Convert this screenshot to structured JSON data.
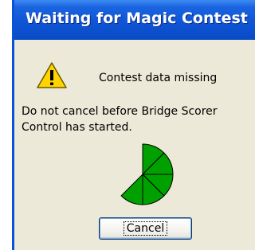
{
  "window": {
    "title": "Waiting for Magic Contest"
  },
  "message": {
    "icon": "warning-icon",
    "title": "Contest data missing",
    "body": "Do not cancel before Bridge Scorer Control has started."
  },
  "progress": {
    "icon": "progress-pie-icon",
    "filled_fraction": 0.625,
    "segments_total": 8,
    "segments_filled": 5,
    "fill_color": "#00a000",
    "stroke_color": "#000000"
  },
  "buttons": {
    "cancel_label": "Cancel"
  },
  "colors": {
    "titlebar": "#0f55d6",
    "dialog_background": "#ece9d8",
    "warning_yellow": "#ffd400"
  }
}
